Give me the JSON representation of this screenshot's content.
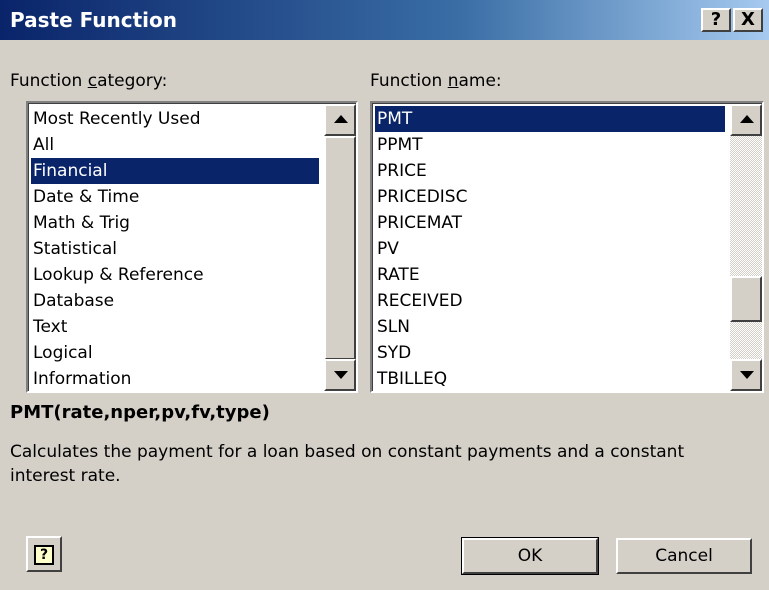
{
  "window": {
    "title": "Paste Function",
    "help_button": "?",
    "close_button": "X"
  },
  "category": {
    "label_prefix": "Function ",
    "label_accel": "c",
    "label_suffix": "ategory:",
    "items": [
      "Most Recently Used",
      "All",
      "Financial",
      "Date & Time",
      "Math & Trig",
      "Statistical",
      "Lookup & Reference",
      "Database",
      "Text",
      "Logical",
      "Information"
    ],
    "selected": "Financial"
  },
  "function_name": {
    "label_prefix": "Function ",
    "label_accel": "n",
    "label_suffix": "ame:",
    "items": [
      "PMT",
      "PPMT",
      "PRICE",
      "PRICEDISC",
      "PRICEMAT",
      "PV",
      "RATE",
      "RECEIVED",
      "SLN",
      "SYD",
      "TBILLEQ"
    ],
    "selected": "PMT"
  },
  "syntax": "PMT(rate,nper,pv,fv,type)",
  "description": "Calculates the payment for a loan based on constant payments and a constant interest rate.",
  "buttons": {
    "help_glyph": "?",
    "ok": "OK",
    "cancel": "Cancel"
  }
}
